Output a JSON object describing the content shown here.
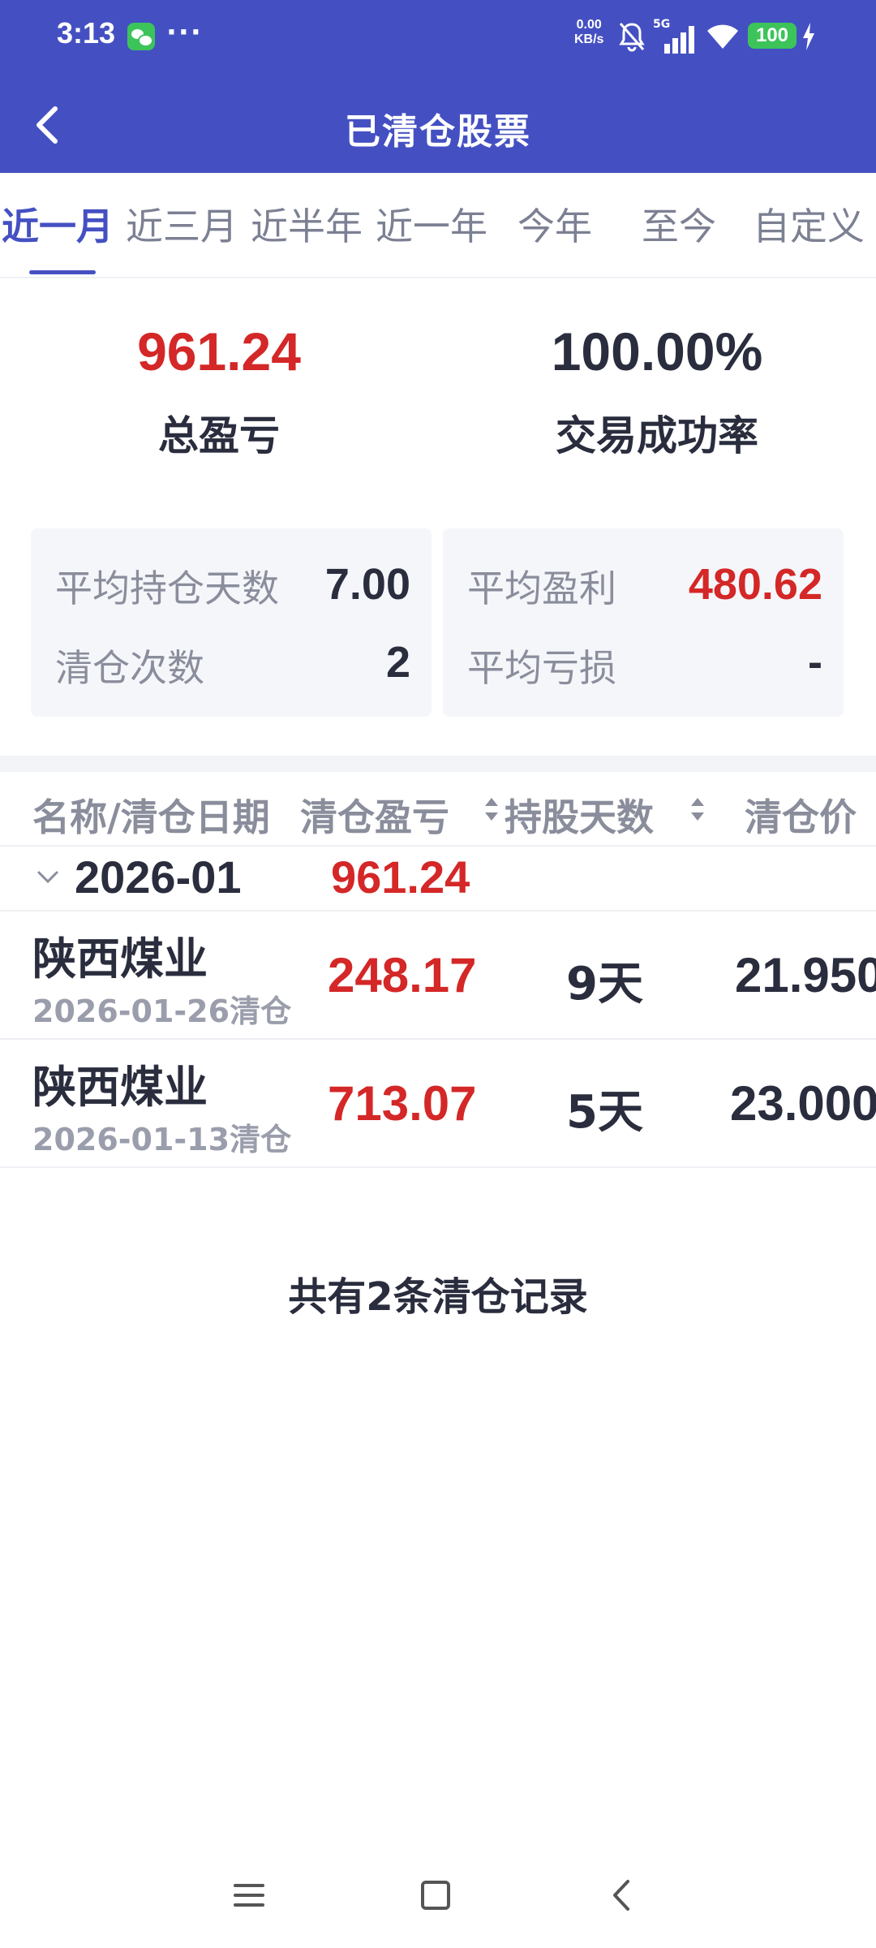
{
  "status_bar": {
    "time": "3:13",
    "more": "···",
    "speed_value": "0.00",
    "speed_unit": "KB/s",
    "network": "5G",
    "battery": "100"
  },
  "header": {
    "title": "已清仓股票"
  },
  "tabs": [
    {
      "label": "近一月",
      "active": true
    },
    {
      "label": "近三月",
      "active": false
    },
    {
      "label": "近半年",
      "active": false
    },
    {
      "label": "近一年",
      "active": false
    },
    {
      "label": "今年",
      "active": false
    },
    {
      "label": "至今",
      "active": false
    },
    {
      "label": "自定义",
      "active": false
    }
  ],
  "summary": {
    "total_pl_value": "961.24",
    "total_pl_label": "总盈亏",
    "success_rate_value": "100.00%",
    "success_rate_label": "交易成功率"
  },
  "stats": {
    "avg_days_label": "平均持仓天数",
    "avg_days_value": "7.00",
    "clear_count_label": "清仓次数",
    "clear_count_value": "2",
    "avg_profit_label": "平均盈利",
    "avg_profit_value": "480.62",
    "avg_loss_label": "平均亏损",
    "avg_loss_value": "-"
  },
  "table": {
    "headers": {
      "name_date": "名称/清仓日期",
      "pl": "清仓盈亏",
      "days": "持股天数",
      "price": "清仓价"
    },
    "group": {
      "month": "2026-01",
      "pl": "961.24"
    },
    "rows": [
      {
        "name": "陕西煤业",
        "date": "2026-01-26清仓",
        "pl": "248.17",
        "days": "9天",
        "price": "21.950"
      },
      {
        "name": "陕西煤业",
        "date": "2026-01-13清仓",
        "pl": "713.07",
        "days": "5天",
        "price": "23.000"
      }
    ]
  },
  "footer": {
    "text": "共有2条清仓记录"
  },
  "colors": {
    "primary": "#4450c2",
    "profit_red": "#d42727",
    "text_dark": "#2a2d3d",
    "card_bg": "#f5f6fa"
  }
}
